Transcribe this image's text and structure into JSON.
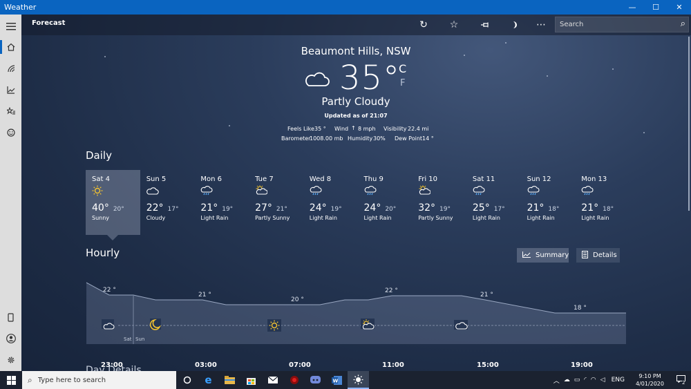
{
  "window": {
    "title": "Weather",
    "minimize": "—",
    "maximize": "☐",
    "close": "✕"
  },
  "toolbar": {
    "title": "Forecast",
    "search_placeholder": "Search"
  },
  "current": {
    "location": "Beaumont Hills, NSW",
    "temp": "35°",
    "unit_c": "C",
    "unit_f": "F",
    "condition": "Partly Cloudy",
    "updated": "Updated as of 21:07",
    "feels_like_label": "Feels Like",
    "feels_like": "35 °",
    "wind_label": "Wind",
    "wind": "8 mph",
    "visibility_label": "Visibility",
    "visibility": "22.4 mi",
    "barometer_label": "Barometer",
    "barometer": "1008.00 mb",
    "humidity_label": "Humidity",
    "humidity": "30%",
    "dewpoint_label": "Dew Point",
    "dewpoint": "14 °"
  },
  "daily": {
    "heading": "Daily",
    "days": [
      {
        "name": "Sat 4",
        "icon": "sun-icon",
        "hi": "40°",
        "lo": "20°",
        "cond": "Sunny"
      },
      {
        "name": "Sun 5",
        "icon": "cloud-icon",
        "hi": "22°",
        "lo": "17°",
        "cond": "Cloudy"
      },
      {
        "name": "Mon 6",
        "icon": "rain-icon",
        "hi": "21°",
        "lo": "19°",
        "cond": "Light Rain"
      },
      {
        "name": "Tue 7",
        "icon": "partly-sunny-icon",
        "hi": "27°",
        "lo": "21°",
        "cond": "Partly Sunny"
      },
      {
        "name": "Wed 8",
        "icon": "rain-icon",
        "hi": "24°",
        "lo": "19°",
        "cond": "Light Rain"
      },
      {
        "name": "Thu 9",
        "icon": "rain-icon",
        "hi": "24°",
        "lo": "20°",
        "cond": "Light Rain"
      },
      {
        "name": "Fri 10",
        "icon": "partly-sunny-icon",
        "hi": "32°",
        "lo": "19°",
        "cond": "Partly Sunny"
      },
      {
        "name": "Sat 11",
        "icon": "rain-icon",
        "hi": "25°",
        "lo": "17°",
        "cond": "Light Rain"
      },
      {
        "name": "Sun 12",
        "icon": "rain-icon",
        "hi": "21°",
        "lo": "18°",
        "cond": "Light Rain"
      },
      {
        "name": "Mon 13",
        "icon": "rain-icon",
        "hi": "21°",
        "lo": "18°",
        "cond": "Light Rain"
      }
    ]
  },
  "hourly": {
    "heading": "Hourly",
    "summary_label": "Summary",
    "details_label": "Details",
    "temp_labels": [
      "22 °",
      "21 °",
      "20 °",
      "22 °",
      "21 °",
      "18 °"
    ],
    "time_labels": [
      "23:00",
      "03:00",
      "07:00",
      "11:00",
      "15:00",
      "19:00"
    ],
    "day_marks": [
      "Sat",
      "Sun"
    ]
  },
  "day_details": {
    "heading": "Day Details"
  },
  "taskbar": {
    "search_placeholder": "Type here to search",
    "lang": "ENG",
    "time": "9:10 PM",
    "date": "4/01/2020",
    "notif_count": "2"
  }
}
